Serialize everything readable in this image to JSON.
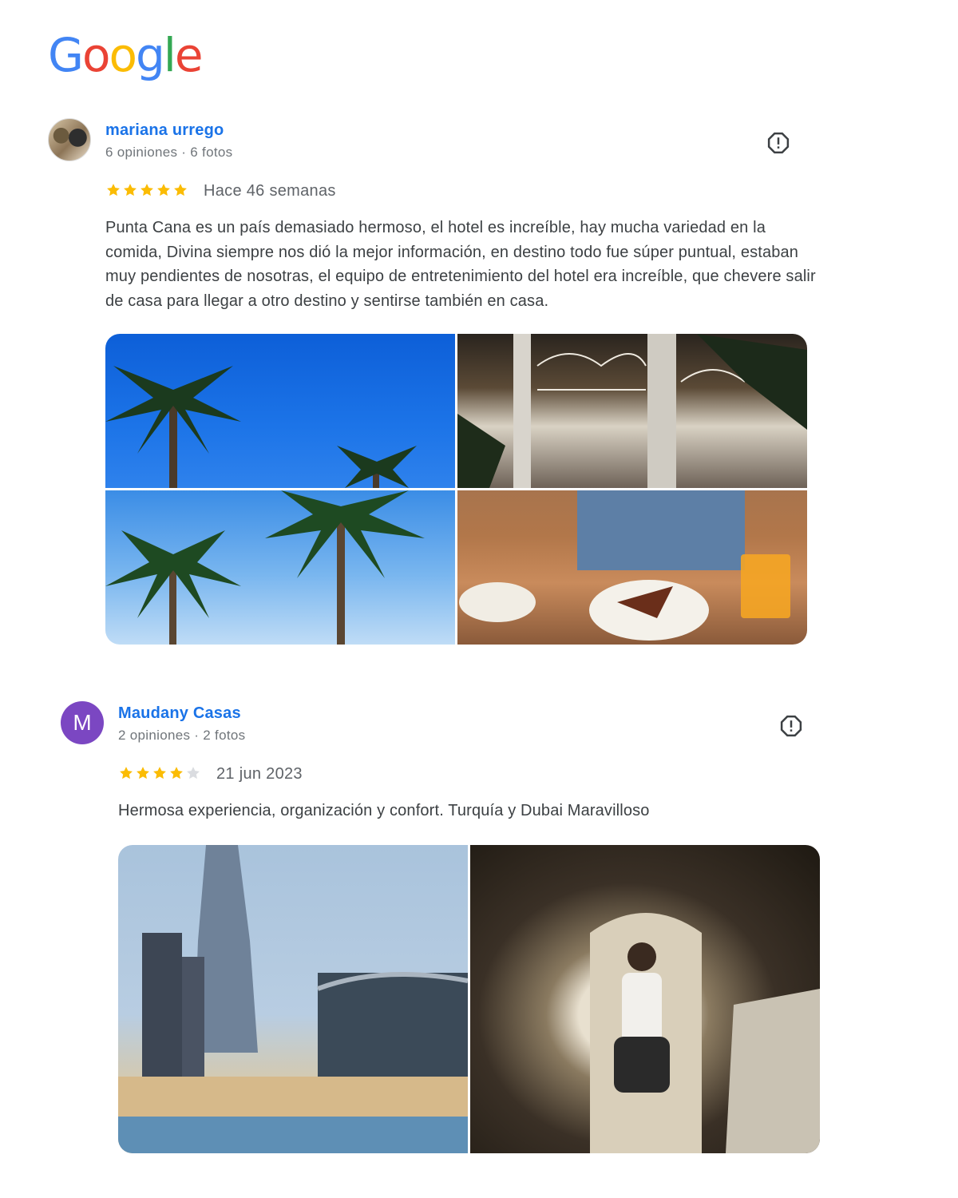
{
  "logo": {
    "letters": [
      "G",
      "o",
      "o",
      "g",
      "l",
      "e"
    ],
    "colors": [
      "#4285F4",
      "#EA4335",
      "#FBBC05",
      "#4285F4",
      "#34A853",
      "#EA4335"
    ]
  },
  "reviews": [
    {
      "author": "mariana urrego",
      "meta": "6 opiniones · 6 fotos",
      "rating": 5,
      "date": "Hace 46 semanas",
      "text": "Punta Cana es un país demasiado hermoso, el hotel es increíble, hay mucha variedad en la comida, Divina siempre nos dió la mejor información, en destino todo fue súper puntual, estaban muy pendientes de nosotras, el equipo de entretenimiento del hotel era increíble, que chevere salir de casa para llegar a otro destino y sentirse también en casa.",
      "photos": [
        "palm-trees-sky",
        "hotel-restaurant",
        "palm-trees-clouds",
        "dessert-plate"
      ]
    },
    {
      "author": "Maudany Casas",
      "avatar_letter": "M",
      "meta": "2 opiniones · 2 fotos",
      "rating": 4,
      "date": "21 jun 2023",
      "text": "Hermosa experiencia, organización y confort. Turquía y Dubai Maravilloso",
      "photos": [
        "dubai-skyline",
        "cave-passage"
      ]
    }
  ],
  "colors": {
    "link": "#1a73e8",
    "star": "#fbbc04",
    "star_empty": "#dadce0",
    "avatar_purple": "#7b47c2"
  }
}
